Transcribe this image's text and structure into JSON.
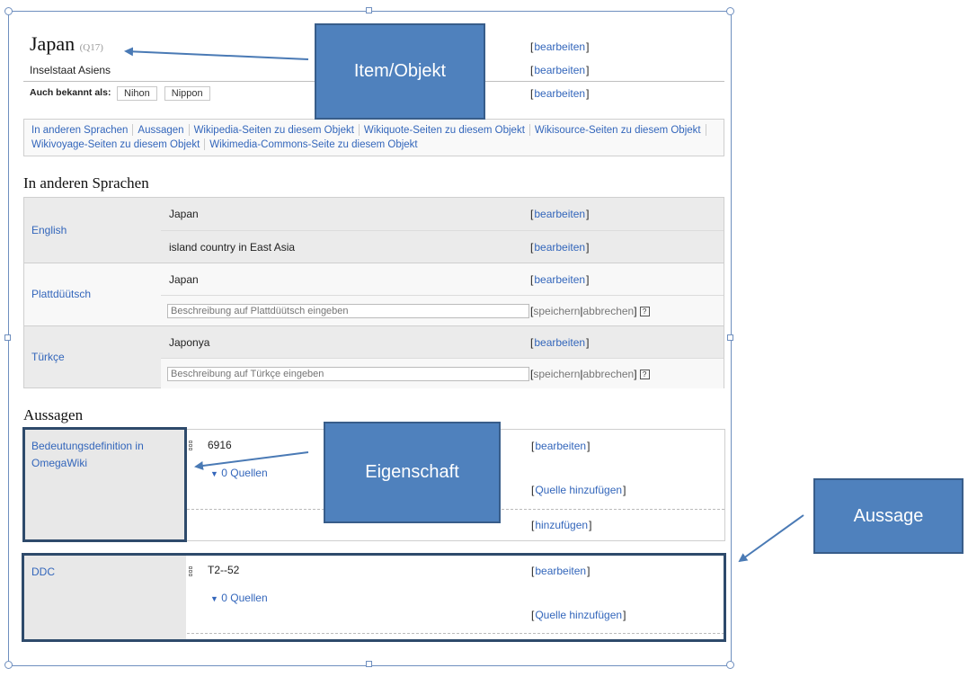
{
  "item": {
    "label": "Japan",
    "id": "(Q17)",
    "description": "Inselstaat Asiens",
    "aliases_label": "Auch bekannt als:",
    "aliases": [
      "Nihon",
      "Nippon"
    ],
    "edit_label": "bearbeiten"
  },
  "toc": {
    "items": [
      "In anderen Sprachen",
      "Aussagen",
      "Wikipedia-Seiten zu diesem Objekt",
      "Wikiquote-Seiten zu diesem Objekt",
      "Wikisource-Seiten zu diesem Objekt",
      "Wikivoyage-Seiten zu diesem Objekt",
      "Wikimedia-Commons-Seite zu diesem Objekt"
    ]
  },
  "languages": {
    "heading": "In anderen Sprachen",
    "rows": [
      {
        "name": "English",
        "label": "Japan",
        "description": "island country in East Asia"
      },
      {
        "name": "Plattdüütsch",
        "label": "Japan",
        "description_placeholder": "Beschreibung auf Plattdüütsch eingeben"
      },
      {
        "name": "Türkçe",
        "label": "Japonya",
        "description_placeholder": "Beschreibung auf Türkçe eingeben"
      }
    ],
    "save_label": "speichern",
    "cancel_label": "abbrechen",
    "help_label": "?"
  },
  "statements": {
    "heading": "Aussagen",
    "items": [
      {
        "property": "Bedeutungsdefinition in OmegaWiki",
        "value": "6916",
        "sources": "0 Quellen"
      },
      {
        "property": "DDC",
        "value": "T2--52",
        "sources": "0 Quellen"
      }
    ],
    "edit_label": "bearbeiten",
    "add_source_label": "Quelle hinzufügen",
    "add_label": "hinzufügen"
  },
  "annotations": {
    "item": "Item/Objekt",
    "property": "Eigenschaft",
    "statement": "Aussage"
  },
  "colors": {
    "link": "#3366bb",
    "callout_fill": "#4f81bd",
    "callout_border": "#385d8a",
    "highlight_border": "#2e4a6b",
    "arrow": "#4a7ab5"
  }
}
